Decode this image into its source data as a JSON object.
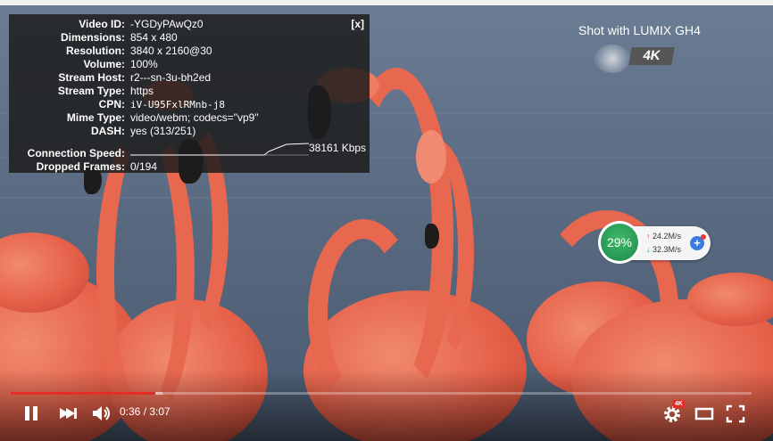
{
  "stats": {
    "close_label": "[x]",
    "rows": [
      {
        "label": "Video ID:",
        "value": "-YGDyPAwQz0"
      },
      {
        "label": "Dimensions:",
        "value": "854 x 480"
      },
      {
        "label": "Resolution:",
        "value": "3840 x 2160@30"
      },
      {
        "label": "Volume:",
        "value": "100%"
      },
      {
        "label": "Stream Host:",
        "value": "r2---sn-3u-bh2ed"
      },
      {
        "label": "Stream Type:",
        "value": "https"
      },
      {
        "label": "CPN:",
        "value": "iV-U95FxlRMnb-j8"
      },
      {
        "label": "Mime Type:",
        "value": "video/webm; codecs=\"vp9\""
      },
      {
        "label": "DASH:",
        "value": "yes (313/251)"
      },
      {
        "label": "Connection Speed:",
        "value": "38161 Kbps"
      },
      {
        "label": "Dropped Frames:",
        "value": "0/194"
      }
    ]
  },
  "watermark": {
    "text": "Shot with LUMIX GH4",
    "badge": "4K"
  },
  "net_widget": {
    "percent": "29%",
    "upload": "24.2M/s",
    "download": "32.3M/s"
  },
  "player": {
    "current_time": "0:36",
    "separator": " / ",
    "duration": "3:07",
    "progress_fraction": 0.195,
    "buffered_fraction": 0.205,
    "quality_badge": "4K",
    "accent": "#e52d27"
  },
  "icons": [
    "pause-icon",
    "next-icon",
    "volume-icon",
    "settings-icon",
    "theater-icon",
    "fullscreen-icon"
  ]
}
